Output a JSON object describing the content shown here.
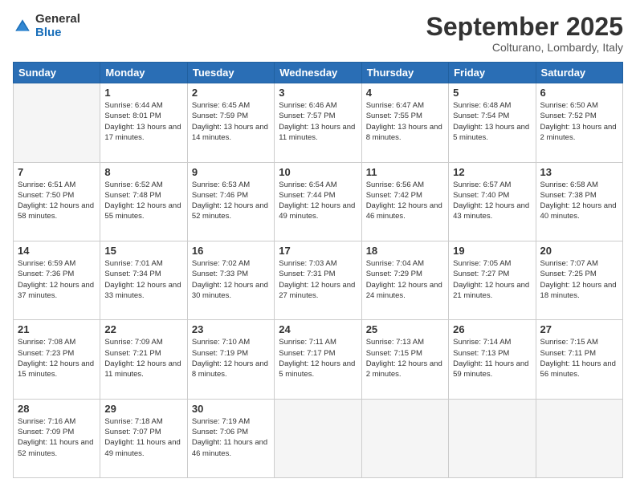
{
  "header": {
    "logo_general": "General",
    "logo_blue": "Blue",
    "month": "September 2025",
    "location": "Colturano, Lombardy, Italy"
  },
  "weekdays": [
    "Sunday",
    "Monday",
    "Tuesday",
    "Wednesday",
    "Thursday",
    "Friday",
    "Saturday"
  ],
  "weeks": [
    [
      {
        "day": "",
        "sunrise": "",
        "sunset": "",
        "daylight": ""
      },
      {
        "day": "1",
        "sunrise": "Sunrise: 6:44 AM",
        "sunset": "Sunset: 8:01 PM",
        "daylight": "Daylight: 13 hours and 17 minutes."
      },
      {
        "day": "2",
        "sunrise": "Sunrise: 6:45 AM",
        "sunset": "Sunset: 7:59 PM",
        "daylight": "Daylight: 13 hours and 14 minutes."
      },
      {
        "day": "3",
        "sunrise": "Sunrise: 6:46 AM",
        "sunset": "Sunset: 7:57 PM",
        "daylight": "Daylight: 13 hours and 11 minutes."
      },
      {
        "day": "4",
        "sunrise": "Sunrise: 6:47 AM",
        "sunset": "Sunset: 7:55 PM",
        "daylight": "Daylight: 13 hours and 8 minutes."
      },
      {
        "day": "5",
        "sunrise": "Sunrise: 6:48 AM",
        "sunset": "Sunset: 7:54 PM",
        "daylight": "Daylight: 13 hours and 5 minutes."
      },
      {
        "day": "6",
        "sunrise": "Sunrise: 6:50 AM",
        "sunset": "Sunset: 7:52 PM",
        "daylight": "Daylight: 13 hours and 2 minutes."
      }
    ],
    [
      {
        "day": "7",
        "sunrise": "Sunrise: 6:51 AM",
        "sunset": "Sunset: 7:50 PM",
        "daylight": "Daylight: 12 hours and 58 minutes."
      },
      {
        "day": "8",
        "sunrise": "Sunrise: 6:52 AM",
        "sunset": "Sunset: 7:48 PM",
        "daylight": "Daylight: 12 hours and 55 minutes."
      },
      {
        "day": "9",
        "sunrise": "Sunrise: 6:53 AM",
        "sunset": "Sunset: 7:46 PM",
        "daylight": "Daylight: 12 hours and 52 minutes."
      },
      {
        "day": "10",
        "sunrise": "Sunrise: 6:54 AM",
        "sunset": "Sunset: 7:44 PM",
        "daylight": "Daylight: 12 hours and 49 minutes."
      },
      {
        "day": "11",
        "sunrise": "Sunrise: 6:56 AM",
        "sunset": "Sunset: 7:42 PM",
        "daylight": "Daylight: 12 hours and 46 minutes."
      },
      {
        "day": "12",
        "sunrise": "Sunrise: 6:57 AM",
        "sunset": "Sunset: 7:40 PM",
        "daylight": "Daylight: 12 hours and 43 minutes."
      },
      {
        "day": "13",
        "sunrise": "Sunrise: 6:58 AM",
        "sunset": "Sunset: 7:38 PM",
        "daylight": "Daylight: 12 hours and 40 minutes."
      }
    ],
    [
      {
        "day": "14",
        "sunrise": "Sunrise: 6:59 AM",
        "sunset": "Sunset: 7:36 PM",
        "daylight": "Daylight: 12 hours and 37 minutes."
      },
      {
        "day": "15",
        "sunrise": "Sunrise: 7:01 AM",
        "sunset": "Sunset: 7:34 PM",
        "daylight": "Daylight: 12 hours and 33 minutes."
      },
      {
        "day": "16",
        "sunrise": "Sunrise: 7:02 AM",
        "sunset": "Sunset: 7:33 PM",
        "daylight": "Daylight: 12 hours and 30 minutes."
      },
      {
        "day": "17",
        "sunrise": "Sunrise: 7:03 AM",
        "sunset": "Sunset: 7:31 PM",
        "daylight": "Daylight: 12 hours and 27 minutes."
      },
      {
        "day": "18",
        "sunrise": "Sunrise: 7:04 AM",
        "sunset": "Sunset: 7:29 PM",
        "daylight": "Daylight: 12 hours and 24 minutes."
      },
      {
        "day": "19",
        "sunrise": "Sunrise: 7:05 AM",
        "sunset": "Sunset: 7:27 PM",
        "daylight": "Daylight: 12 hours and 21 minutes."
      },
      {
        "day": "20",
        "sunrise": "Sunrise: 7:07 AM",
        "sunset": "Sunset: 7:25 PM",
        "daylight": "Daylight: 12 hours and 18 minutes."
      }
    ],
    [
      {
        "day": "21",
        "sunrise": "Sunrise: 7:08 AM",
        "sunset": "Sunset: 7:23 PM",
        "daylight": "Daylight: 12 hours and 15 minutes."
      },
      {
        "day": "22",
        "sunrise": "Sunrise: 7:09 AM",
        "sunset": "Sunset: 7:21 PM",
        "daylight": "Daylight: 12 hours and 11 minutes."
      },
      {
        "day": "23",
        "sunrise": "Sunrise: 7:10 AM",
        "sunset": "Sunset: 7:19 PM",
        "daylight": "Daylight: 12 hours and 8 minutes."
      },
      {
        "day": "24",
        "sunrise": "Sunrise: 7:11 AM",
        "sunset": "Sunset: 7:17 PM",
        "daylight": "Daylight: 12 hours and 5 minutes."
      },
      {
        "day": "25",
        "sunrise": "Sunrise: 7:13 AM",
        "sunset": "Sunset: 7:15 PM",
        "daylight": "Daylight: 12 hours and 2 minutes."
      },
      {
        "day": "26",
        "sunrise": "Sunrise: 7:14 AM",
        "sunset": "Sunset: 7:13 PM",
        "daylight": "Daylight: 11 hours and 59 minutes."
      },
      {
        "day": "27",
        "sunrise": "Sunrise: 7:15 AM",
        "sunset": "Sunset: 7:11 PM",
        "daylight": "Daylight: 11 hours and 56 minutes."
      }
    ],
    [
      {
        "day": "28",
        "sunrise": "Sunrise: 7:16 AM",
        "sunset": "Sunset: 7:09 PM",
        "daylight": "Daylight: 11 hours and 52 minutes."
      },
      {
        "day": "29",
        "sunrise": "Sunrise: 7:18 AM",
        "sunset": "Sunset: 7:07 PM",
        "daylight": "Daylight: 11 hours and 49 minutes."
      },
      {
        "day": "30",
        "sunrise": "Sunrise: 7:19 AM",
        "sunset": "Sunset: 7:06 PM",
        "daylight": "Daylight: 11 hours and 46 minutes."
      },
      {
        "day": "",
        "sunrise": "",
        "sunset": "",
        "daylight": ""
      },
      {
        "day": "",
        "sunrise": "",
        "sunset": "",
        "daylight": ""
      },
      {
        "day": "",
        "sunrise": "",
        "sunset": "",
        "daylight": ""
      },
      {
        "day": "",
        "sunrise": "",
        "sunset": "",
        "daylight": ""
      }
    ]
  ]
}
